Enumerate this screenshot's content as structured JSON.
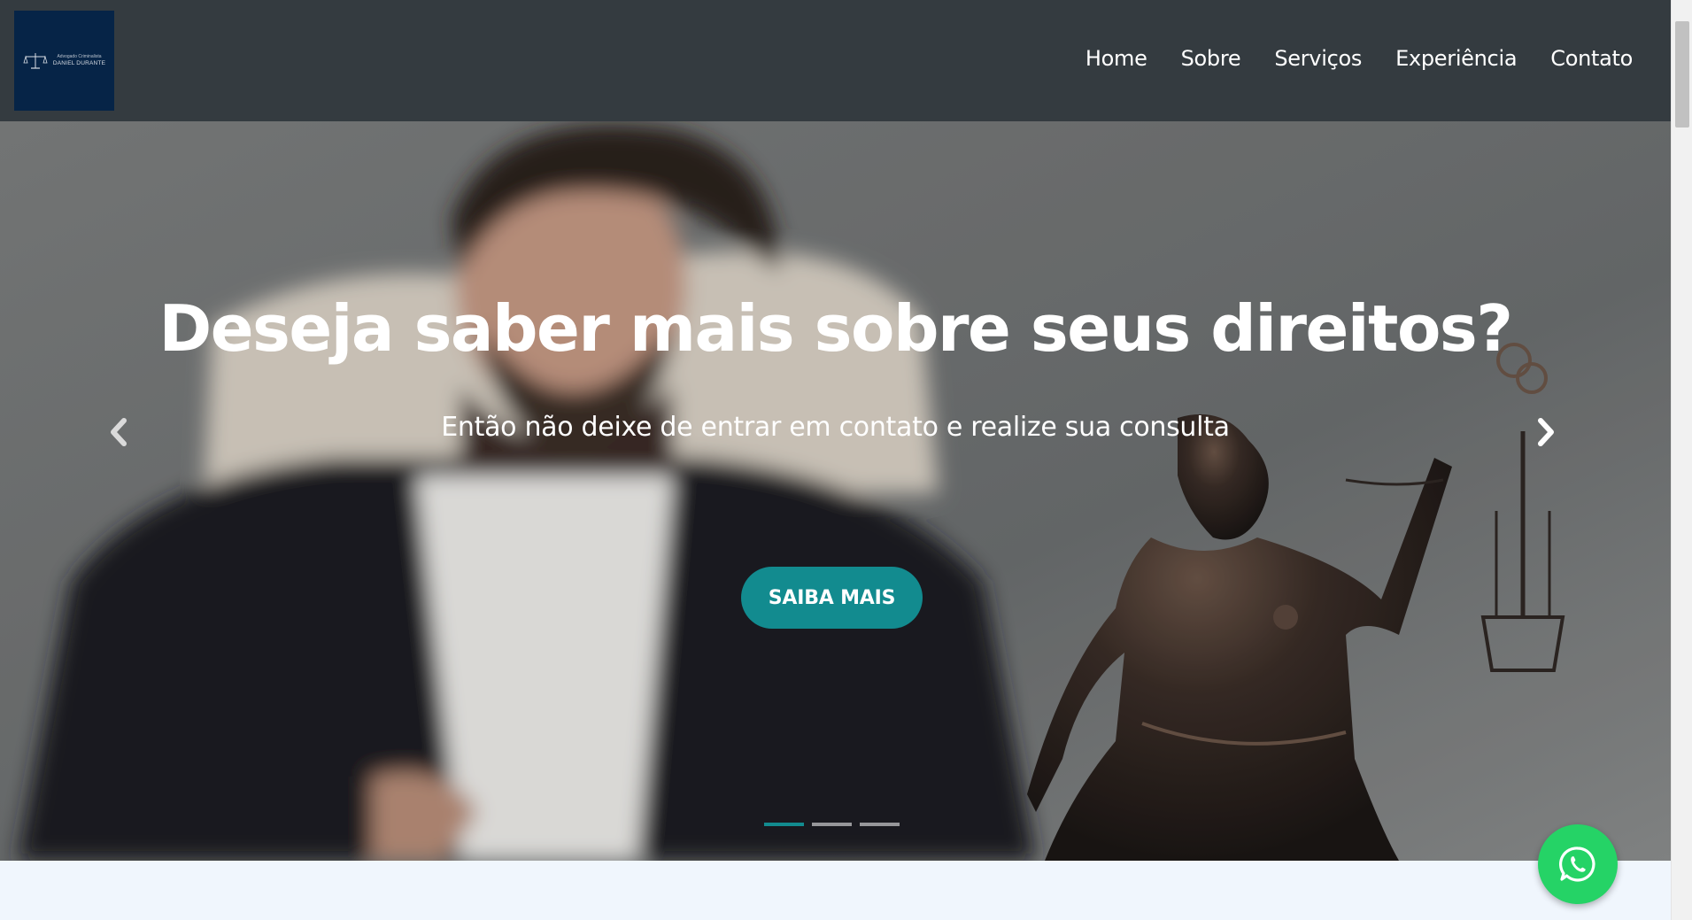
{
  "header": {
    "logo": {
      "line1": "Advogado Criminalista",
      "line2": "DANIEL DURANTE"
    },
    "nav": [
      {
        "label": "Home"
      },
      {
        "label": "Sobre"
      },
      {
        "label": "Serviços"
      },
      {
        "label": "Experiência"
      },
      {
        "label": "Contato"
      }
    ]
  },
  "hero": {
    "title": "Deseja saber mais sobre seus direitos?",
    "subtitle": "Então não deixe de entrar em contato e realize sua consulta",
    "button_label": "SAIBA MAIS",
    "slides_count": 3,
    "active_slide": 1
  },
  "colors": {
    "header_bg": "#343b40",
    "logo_bg": "#062447",
    "accent": "#128b8f",
    "whatsapp": "#25d366",
    "page_bg": "#f0f6fd"
  },
  "icons": {
    "prev": "chevron-left-icon",
    "next": "chevron-right-icon",
    "whatsapp": "whatsapp-icon",
    "logo": "scales-of-justice-icon"
  }
}
